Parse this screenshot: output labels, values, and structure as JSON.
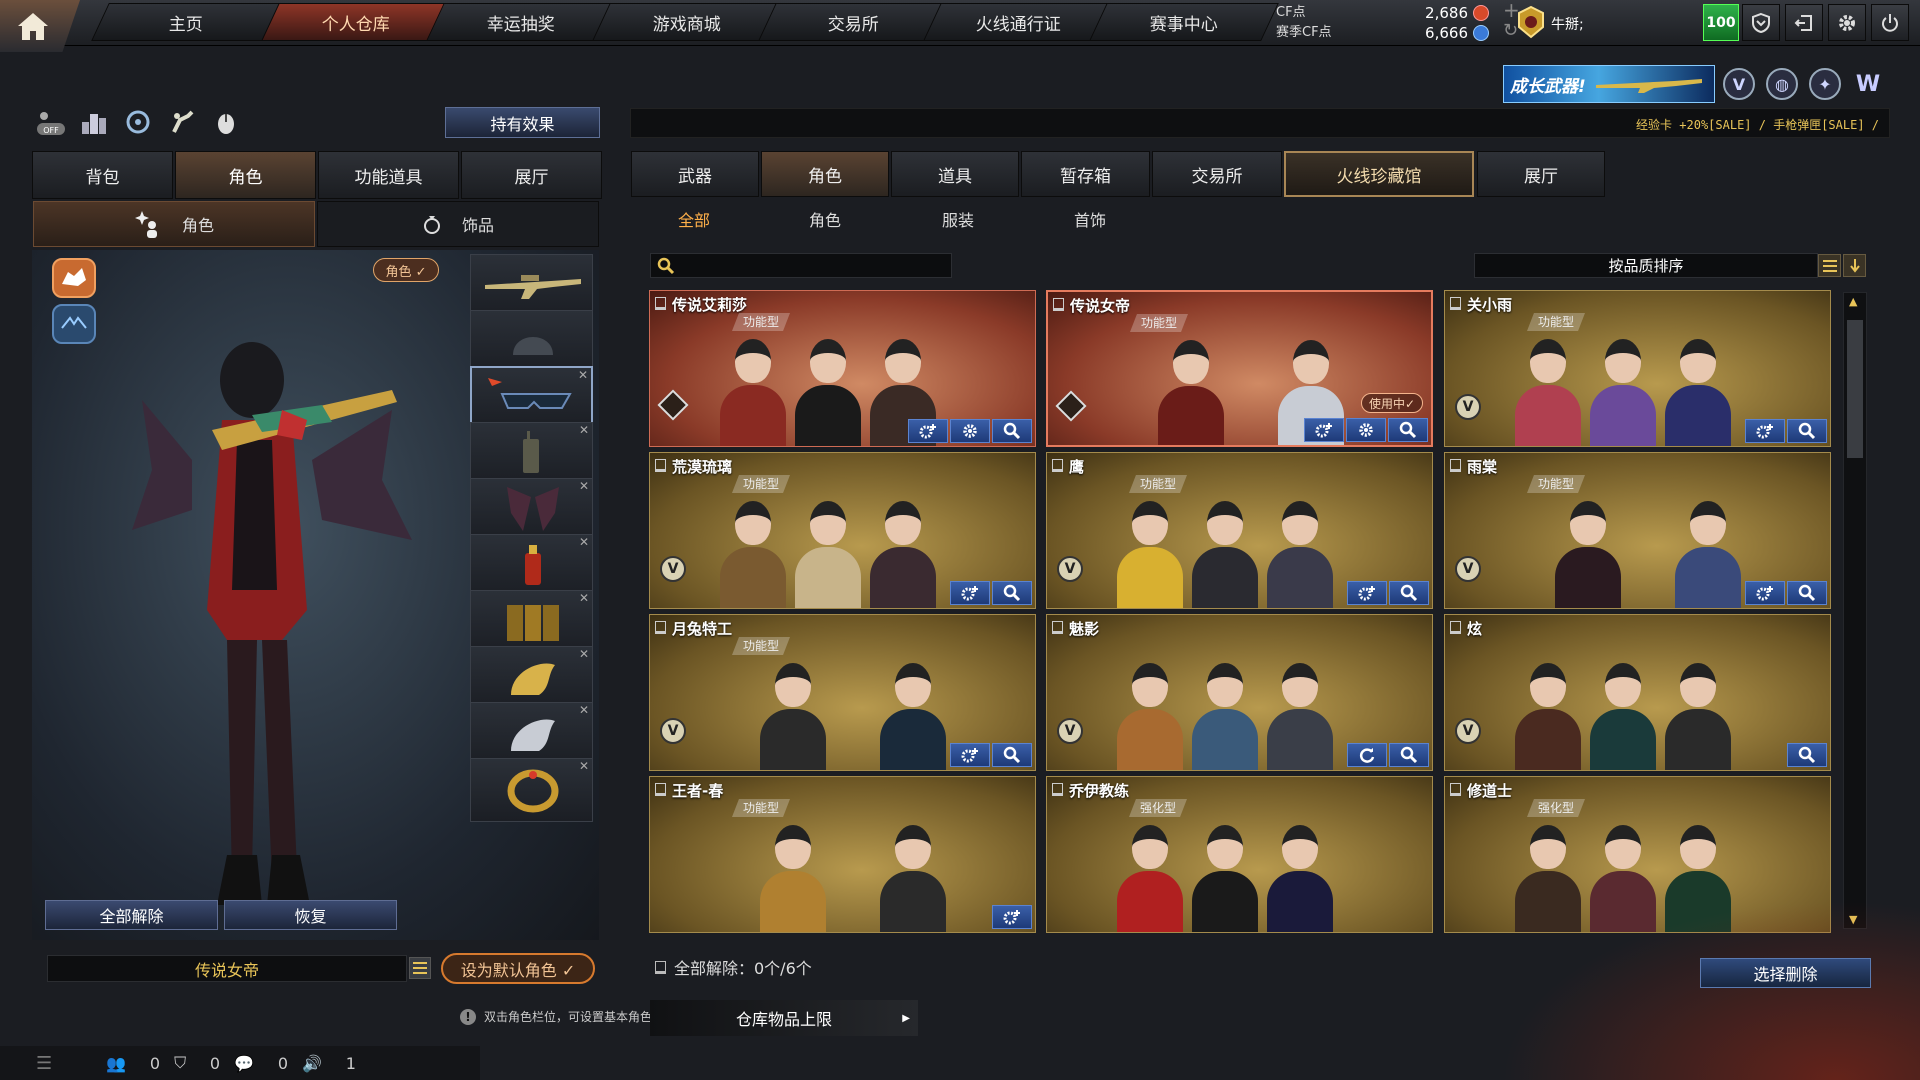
{
  "nav": {
    "tabs": [
      {
        "label": "主页"
      },
      {
        "label": "个人仓库"
      },
      {
        "label": "幸运抽奖"
      },
      {
        "label": "游戏商城"
      },
      {
        "label": "交易所"
      },
      {
        "label": "火线通行证"
      },
      {
        "label": "赛事中心"
      }
    ],
    "active_tab": "个人仓库"
  },
  "currency": {
    "cf_label": "CF点",
    "cf_value": "2,686",
    "season_label": "赛季CF点",
    "season_value": "6,666"
  },
  "user": {
    "name": "牛掰;",
    "level": "100"
  },
  "promo": {
    "text": "成长武器!"
  },
  "ticker": "经验卡 +20%[SALE] / 手枪弹匣[SALE] /",
  "left": {
    "effect_button": "持有效果",
    "tabs": [
      {
        "label": "背包"
      },
      {
        "label": "角色"
      },
      {
        "label": "功能道具"
      },
      {
        "label": "展厅"
      }
    ],
    "active_tab": "角色",
    "subtabs": [
      {
        "label": "角色"
      },
      {
        "label": "饰品"
      }
    ],
    "role_tag": "角色 ✓",
    "unequip_all": "全部解除",
    "restore": "恢复",
    "character_name": "传说女帝",
    "set_default": "设为默认角色 ✓",
    "hint": "双击角色栏位，可设置基本角色。",
    "storage_limit": "仓库物品上限"
  },
  "status_bar": {
    "v1": "0",
    "v2": "0",
    "v3": "0",
    "v4": "1"
  },
  "right": {
    "tabs": [
      {
        "label": "武器"
      },
      {
        "label": "角色"
      },
      {
        "label": "道具"
      },
      {
        "label": "暂存箱"
      },
      {
        "label": "交易所"
      },
      {
        "label": "火线珍藏馆"
      },
      {
        "label": "展厅"
      }
    ],
    "active_tab": "角色",
    "subtabs": [
      {
        "label": "全部"
      },
      {
        "label": "角色"
      },
      {
        "label": "服装"
      },
      {
        "label": "首饰"
      }
    ],
    "active_subtab": "全部",
    "sort_label": "按品质排序",
    "unequip_status": "全部解除：0个/6个",
    "select_delete": "选择删除"
  },
  "cards": [
    {
      "title": "传说艾莉莎",
      "type": "功能型",
      "theme": "red",
      "badge": "diamond",
      "in_use": "",
      "buttons": [
        "gear-plus",
        "gear",
        "search"
      ],
      "fig_colors": [
        "#8a2a22",
        "#1a1a1a",
        "#3a2a25"
      ]
    },
    {
      "title": "传说女帝",
      "type": "功能型",
      "theme": "red",
      "badge": "diamond",
      "in_use": "使用中✓",
      "buttons": [
        "gear-plus",
        "gear",
        "search"
      ],
      "fig_colors": [
        "#6a1c18",
        "#c8ccd4"
      ]
    },
    {
      "title": "关小雨",
      "type": "功能型",
      "theme": "gold",
      "badge": "v",
      "in_use": "",
      "buttons": [
        "gear-plus",
        "search"
      ],
      "fig_colors": [
        "#b04050",
        "#6a4a9a",
        "#2a2e6a"
      ]
    },
    {
      "title": "荒漠琉璃",
      "type": "功能型",
      "theme": "gold",
      "badge": "v",
      "in_use": "",
      "buttons": [
        "gear-plus",
        "search"
      ],
      "fig_colors": [
        "#7a5a30",
        "#c8b48a",
        "#3a2a30"
      ]
    },
    {
      "title": "鹰",
      "type": "功能型",
      "theme": "gold",
      "badge": "v",
      "in_use": "",
      "buttons": [
        "gear-plus",
        "search"
      ],
      "fig_colors": [
        "#d8b030",
        "#2a2a30",
        "#3a3a4a"
      ]
    },
    {
      "title": "雨棠",
      "type": "功能型",
      "theme": "gold",
      "badge": "v",
      "in_use": "",
      "buttons": [
        "gear-plus",
        "search"
      ],
      "fig_colors": [
        "#2a1a20",
        "#3a4a7a"
      ]
    },
    {
      "title": "月兔特工",
      "type": "功能型",
      "theme": "gold",
      "badge": "v",
      "in_use": "",
      "buttons": [
        "gear-plus",
        "search"
      ],
      "fig_colors": [
        "#2a2a2a",
        "#1a2a3a"
      ]
    },
    {
      "title": "魅影",
      "type": "",
      "theme": "gold",
      "badge": "v",
      "in_use": "",
      "buttons": [
        "refresh",
        "search"
      ],
      "fig_colors": [
        "#a86a30",
        "#3a5a7a",
        "#3a3e48"
      ]
    },
    {
      "title": "炫",
      "type": "",
      "theme": "gold",
      "badge": "v",
      "in_use": "",
      "buttons": [
        "search"
      ],
      "fig_colors": [
        "#4a2a20",
        "#1a3a3a",
        "#2a2a2a"
      ]
    },
    {
      "title": "王者-春",
      "type": "功能型",
      "theme": "gold",
      "badge": "",
      "in_use": "",
      "buttons": [
        "gear-plus"
      ],
      "fig_colors": [
        "#b08030",
        "#2a2a2a"
      ]
    },
    {
      "title": "乔伊教练",
      "type": "强化型",
      "theme": "gold",
      "badge": "",
      "in_use": "",
      "buttons": [],
      "fig_colors": [
        "#b02020",
        "#1a1a1a",
        "#1a1a3a"
      ]
    },
    {
      "title": "修道士",
      "type": "强化型",
      "theme": "gold",
      "badge": "",
      "in_use": "",
      "buttons": [],
      "fig_colors": [
        "#3a2a20",
        "#5a2a30",
        "#1a3a2a"
      ]
    }
  ]
}
